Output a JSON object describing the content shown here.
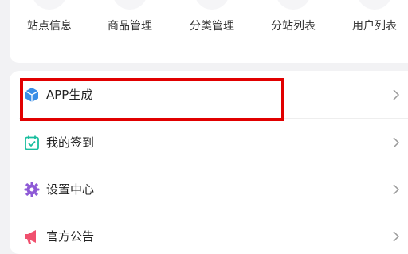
{
  "shortcuts": [
    {
      "label": "站点信息",
      "icon": "broadcast-icon",
      "color": "#f5a623"
    },
    {
      "label": "商品管理",
      "icon": "shopping-bag-icon",
      "color": "#f0506e"
    },
    {
      "label": "分类管理",
      "icon": "category-grid-icon",
      "color": "#3a8ee6"
    },
    {
      "label": "分站列表",
      "icon": "sitemap-icon",
      "color": "#19be6b"
    },
    {
      "label": "用户列表",
      "icon": "users-icon",
      "color": "#c86dd7"
    }
  ],
  "menu": [
    {
      "label": "APP生成",
      "icon": "cube-icon",
      "color": "#3a8ee6"
    },
    {
      "label": "我的签到",
      "icon": "calendar-check-icon",
      "color": "#19be9f"
    },
    {
      "label": "设置中心",
      "icon": "gear-icon",
      "color": "#8e5ad6"
    },
    {
      "label": "官方公告",
      "icon": "megaphone-icon",
      "color": "#f0506e"
    }
  ],
  "highlight_color": "#e10000"
}
